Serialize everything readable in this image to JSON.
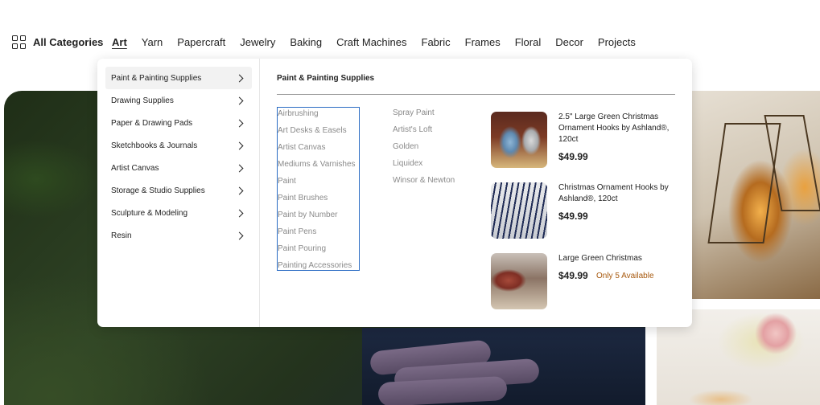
{
  "nav": {
    "all_categories": "All Categories",
    "links": [
      "Art",
      "Yarn",
      "Papercraft",
      "Jewelry",
      "Baking",
      "Craft Machines",
      "Fabric",
      "Frames",
      "Floral",
      "Decor",
      "Projects"
    ],
    "active": "Art"
  },
  "dropdown": {
    "categories": [
      "Paint & Painting Supplies",
      "Drawing Supplies",
      "Paper & Drawing Pads",
      "Sketchbooks & Journals",
      "Artist Canvas",
      "Storage & Studio Supplies",
      "Sculpture & Modeling",
      "Resin"
    ],
    "active_category": "Paint & Painting Supplies",
    "pane_title": "Paint & Painting Supplies",
    "subcategories_col1": [
      "Airbrushing",
      "Art Desks & Easels",
      "Artist Canvas",
      "Mediums & Varnishes",
      "Paint",
      "Paint Brushes",
      "Paint by Number",
      "Paint Pens",
      "Paint Pouring",
      "Painting Accessories"
    ],
    "subcategories_col2": [
      "Spray Paint",
      "Artist's Loft",
      "Golden",
      "Liquidex",
      "Winsor & Newton"
    ],
    "products": [
      {
        "title": "2.5\" Large Green Christmas Ornament Hooks by Ashland®, 120ct",
        "price": "$49.99",
        "availability": ""
      },
      {
        "title": "Christmas Ornament Hooks by Ashland®, 120ct",
        "price": "$49.99",
        "availability": ""
      },
      {
        "title": "Large Green Christmas",
        "price": "$49.99",
        "availability": "Only 5 Available"
      }
    ]
  },
  "colors": {
    "focus_outline": "#2b6cc4",
    "availability": "#a7590e",
    "subcategory_text": "#8a8a8a"
  }
}
